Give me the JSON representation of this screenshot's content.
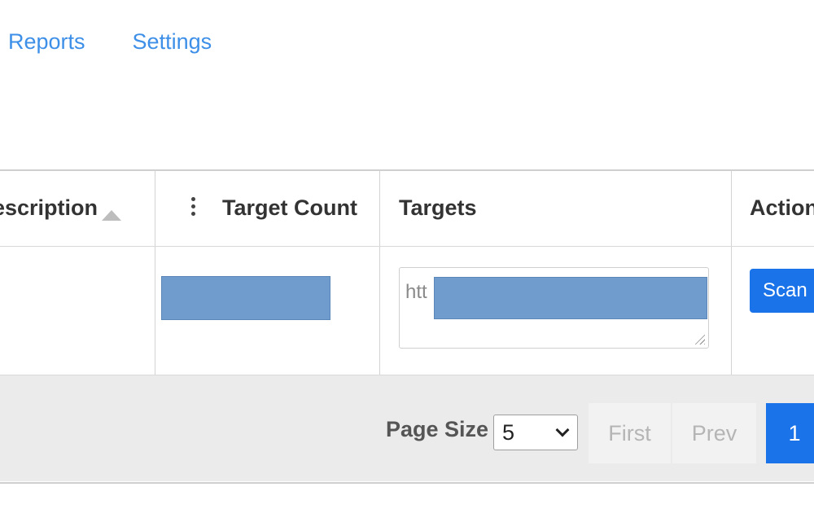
{
  "nav": {
    "items": [
      {
        "label": "Reports"
      },
      {
        "label": "Settings"
      }
    ]
  },
  "table": {
    "columns": [
      {
        "label": "escription"
      },
      {
        "label": "Target Count"
      },
      {
        "label": "Targets"
      },
      {
        "label": "Action"
      }
    ],
    "rows": [
      {
        "targets_prefix": "htt",
        "action_label": "Scan"
      }
    ]
  },
  "pagination": {
    "page_size_label": "Page Size",
    "page_size_value": "5",
    "first_label": "First",
    "prev_label": "Prev",
    "current_page": "1"
  },
  "colors": {
    "link": "#3d8fe8",
    "primary": "#1a73e8",
    "redaction": "#6f9ccd"
  },
  "icons": [
    "sort-ascending-icon",
    "kebab-menu-icon",
    "resize-grip-icon",
    "chevron-down-icon"
  ]
}
